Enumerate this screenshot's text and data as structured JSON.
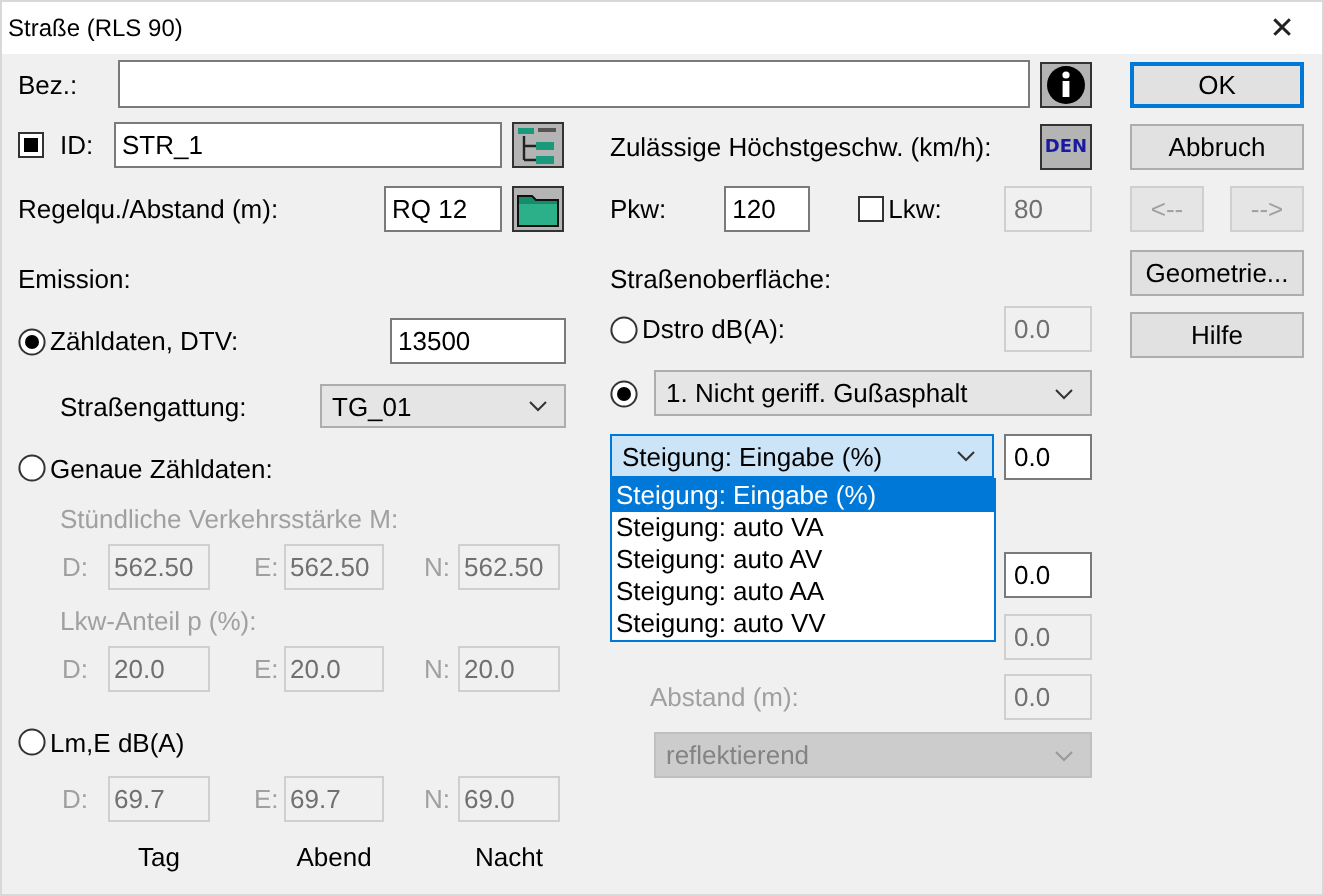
{
  "window": {
    "title": "Straße (RLS 90)",
    "close": "✕"
  },
  "bez": {
    "label": "Bez.:"
  },
  "id": {
    "checked": true,
    "label": "ID:",
    "value": "STR_1"
  },
  "regelquerschnitt": {
    "label": "Regelqu./Abstand (m):",
    "value": "RQ 12"
  },
  "emission": {
    "heading": "Emission:",
    "options": [
      {
        "kind": "dtv",
        "label": "Zähldaten, DTV:",
        "selected": true,
        "value": "13500",
        "type_label": "Straßengattung:",
        "type_value": "TG_01"
      },
      {
        "kind": "exact",
        "label": "Genaue Zähldaten:",
        "selected": false,
        "groups": [
          {
            "label": "Stündliche Verkehrsstärke M:",
            "disabled": true,
            "fields": [
              {
                "label": "D:",
                "value": "562.50"
              },
              {
                "label": "E:",
                "value": "562.50"
              },
              {
                "label": "N:",
                "value": "562.50"
              }
            ]
          },
          {
            "label": "Lkw-Anteil p (%):",
            "disabled": true,
            "fields": [
              {
                "label": "D:",
                "value": "20.0"
              },
              {
                "label": "E:",
                "value": "20.0"
              },
              {
                "label": "N:",
                "value": "20.0"
              }
            ]
          }
        ]
      },
      {
        "kind": "level",
        "label": "Lm,E dB(A)",
        "selected": false,
        "disabled": true,
        "fields": [
          {
            "label": "D:",
            "value": "69.7"
          },
          {
            "label": "E:",
            "value": "69.7"
          },
          {
            "label": "N:",
            "value": "69.0"
          }
        ]
      }
    ]
  },
  "periods": [
    "Tag",
    "Abend",
    "Nacht"
  ],
  "speed": {
    "label": "Zulässige Höchstgeschw. (km/h):",
    "badge": "DEN",
    "pkw": {
      "label": "Pkw:",
      "value": "120"
    },
    "lkw": {
      "label": "Lkw:",
      "checked": false,
      "value": "80",
      "disabled": true
    }
  },
  "surface": {
    "heading": "Straßenoberfläche:",
    "options": [
      {
        "kind": "dstro",
        "label": "Dstro dB(A):",
        "selected": false,
        "value": "0.0",
        "disabled": true
      },
      {
        "kind": "type",
        "selected": true,
        "value": "1. Nicht geriff. Gußasphalt"
      }
    ]
  },
  "slope": {
    "value": "Steigung: Eingabe (%)",
    "expanded": true,
    "input": "0.0",
    "options": [
      {
        "label": "Steigung: Eingabe (%)",
        "selected": true
      },
      {
        "label": "Steigung: auto VA",
        "selected": false
      },
      {
        "label": "Steigung: auto AV",
        "selected": false
      },
      {
        "label": "Steigung: auto AA",
        "selected": false
      },
      {
        "label": "Steigung: auto VV",
        "selected": false
      }
    ]
  },
  "covered_fields": [
    {
      "value": "0.0",
      "disabled": false
    },
    {
      "value": "0.0",
      "disabled": true
    }
  ],
  "abstand": {
    "label": "Abstand (m):",
    "value": "0.0",
    "disabled": true
  },
  "reflection": {
    "value": "reflektierend",
    "disabled": true
  },
  "buttons": {
    "top": [
      {
        "label": "OK",
        "default": true
      },
      {
        "label": "Abbruch",
        "default": false
      }
    ],
    "nav": [
      {
        "label": "<--",
        "disabled": true
      },
      {
        "label": "-->",
        "disabled": true
      }
    ],
    "bottom": [
      {
        "label": "Geometrie..."
      },
      {
        "label": "Hilfe"
      }
    ]
  }
}
